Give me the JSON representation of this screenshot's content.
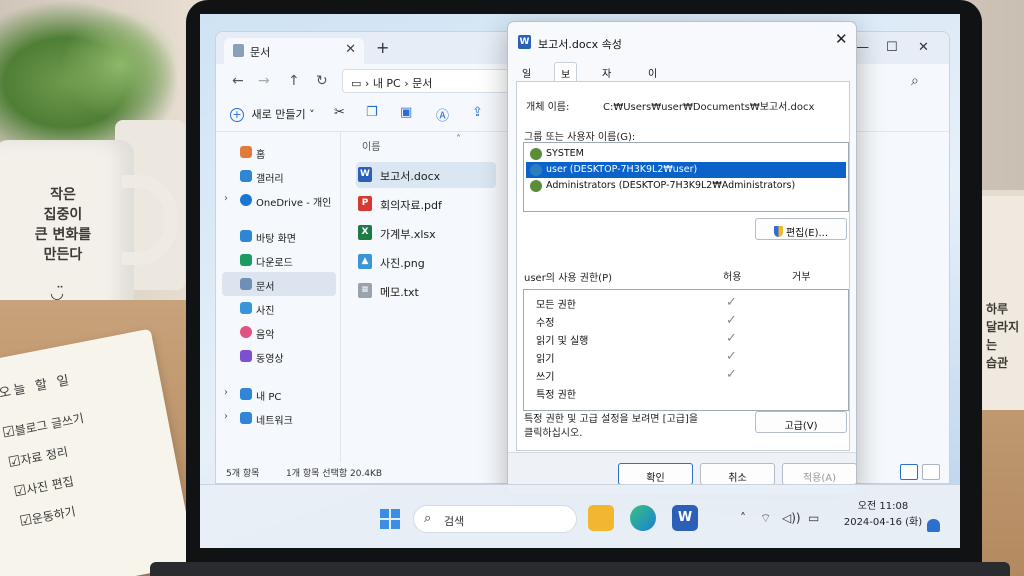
{
  "background": {
    "mug_text": [
      "작은",
      "집중이",
      "큰 변화를",
      "만든다"
    ],
    "notepad_title": "오늘 할 일",
    "notepad_items": [
      "블로그 글쓰기",
      "자료 정리",
      "사진 편집",
      "운동하기"
    ],
    "book_text": [
      "하루",
      "달라지는",
      "습관"
    ]
  },
  "explorer": {
    "tab_title": "문서",
    "breadcrumb": [
      "내 PC",
      "문서"
    ],
    "new_button": "새로 만들기",
    "column_header": "이름",
    "sidebar": [
      {
        "label": "홈",
        "icon": "home-icon",
        "color": "#e07b39"
      },
      {
        "label": "갤러리",
        "icon": "gallery-icon",
        "color": "#2f86d6"
      },
      {
        "label": "OneDrive - 개인",
        "icon": "cloud-icon",
        "color": "#1976d2"
      },
      {
        "label": "바탕 화면",
        "icon": "desktop-icon",
        "color": "#2f86d6"
      },
      {
        "label": "다운로드",
        "icon": "download-icon",
        "color": "#1c9b64"
      },
      {
        "label": "문서",
        "icon": "documents-icon",
        "color": "#6f8fb3"
      },
      {
        "label": "사진",
        "icon": "pictures-icon",
        "color": "#3a95d8"
      },
      {
        "label": "음악",
        "icon": "music-icon",
        "color": "#e05280"
      },
      {
        "label": "동영상",
        "icon": "video-icon",
        "color": "#7d4fd1"
      },
      {
        "label": "내 PC",
        "icon": "computer-icon",
        "color": "#2f86d6"
      },
      {
        "label": "네트워크",
        "icon": "network-icon",
        "color": "#2f86d6"
      }
    ],
    "files": [
      {
        "name": "보고서.docx",
        "icon": "word-icon",
        "color": "#2b5fb8",
        "glyph": "W"
      },
      {
        "name": "회의자료.pdf",
        "icon": "pdf-icon",
        "color": "#d53a32",
        "glyph": "P"
      },
      {
        "name": "가계부.xlsx",
        "icon": "excel-icon",
        "color": "#1e7b45",
        "glyph": "X"
      },
      {
        "name": "사진.png",
        "icon": "image-icon",
        "color": "#3a95d8",
        "glyph": "▲"
      },
      {
        "name": "메모.txt",
        "icon": "text-file-icon",
        "color": "#9aa3ad",
        "glyph": "≡"
      }
    ],
    "status_count": "5개 항목",
    "status_selected": "1개 항목 선택함 20.4KB"
  },
  "dialog": {
    "title": "보고서.docx 속성",
    "tabs": [
      "일반",
      "보안",
      "자세히",
      "이전 버전"
    ],
    "object_name_label": "개체 이름:",
    "object_name_value": "C:₩Users₩user₩Documents₩보고서.docx",
    "group_label": "그룹 또는 사용자 이름(G):",
    "users": [
      {
        "name": "SYSTEM",
        "color": "#5b8c3a"
      },
      {
        "name": "user (DESKTOP-7H3K9L2₩user)",
        "color": "#2b7fbf"
      },
      {
        "name": "Administrators (DESKTOP-7H3K9L2₩Administrators)",
        "color": "#5b8c3a"
      }
    ],
    "edit_button": "편집(E)...",
    "perm_label": "user의 사용 권한(P)",
    "allow_label": "허용",
    "deny_label": "거부",
    "permissions": [
      {
        "name": "모든 권한",
        "allow": true
      },
      {
        "name": "수정",
        "allow": true
      },
      {
        "name": "읽기 및 실행",
        "allow": true
      },
      {
        "name": "읽기",
        "allow": true
      },
      {
        "name": "쓰기",
        "allow": true
      },
      {
        "name": "특정 권한",
        "allow": false
      }
    ],
    "advanced_note_1": "특정 권한 및 고급 설정을 보려면 [고급]을",
    "advanced_note_2": "클릭하십시오.",
    "advanced_button": "고급(V)",
    "ok_button": "확인",
    "cancel_button": "취소",
    "apply_button": "적용(A)"
  },
  "taskbar": {
    "search_placeholder": "검색",
    "time": "오전 11:08",
    "date": "2024-04-16 (화)"
  }
}
